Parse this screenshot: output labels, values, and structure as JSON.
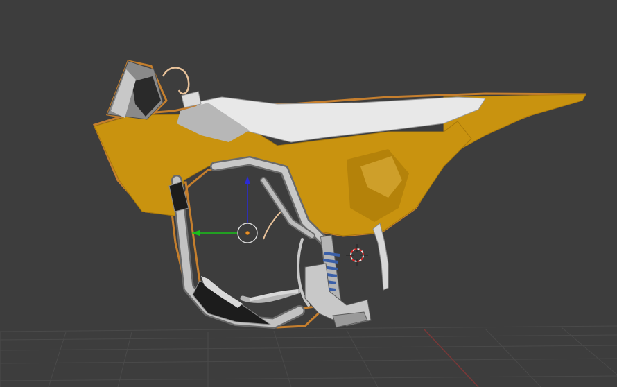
{
  "viewport": {
    "background": "#3d3d3d",
    "grid_color": "#4a4a4a",
    "x_axis_color": "#7a3838",
    "selection_outline_color": "#e8902a",
    "view_label": ""
  },
  "model": {
    "shroud_color": "#c9930f",
    "seat_color": "#e8e8e8",
    "frame_color": "#b9b9b9",
    "shock_spring_color": "#3a5fa8",
    "skid_plate_color": "#1c1c1c"
  },
  "gizmo": {
    "y_axis_color": "#2b2bd6",
    "x_axis_color": "#19c019",
    "pivot_ring_color": "#e8e8e8",
    "pivot_dot_color": "#e8902a"
  },
  "icons": {
    "cursor": "3d-cursor-icon"
  }
}
